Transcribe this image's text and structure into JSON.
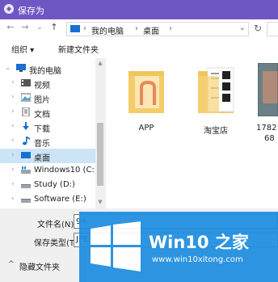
{
  "window": {
    "title": "保存为"
  },
  "nav": {
    "back": "←",
    "forward": "→",
    "dropdown": "⌄",
    "up": "↑",
    "breadcrumbs": [
      "我的电脑",
      "桌面"
    ],
    "refresh": "↻"
  },
  "toolbar": {
    "organize": "组织 ▾",
    "new_folder": "新建文件夹"
  },
  "sidebar": {
    "items": [
      {
        "label": "我的电脑",
        "icon": "computer-icon"
      },
      {
        "label": "视频",
        "icon": "video-icon"
      },
      {
        "label": "图片",
        "icon": "pictures-icon"
      },
      {
        "label": "文档",
        "icon": "documents-icon"
      },
      {
        "label": "下载",
        "icon": "download-icon"
      },
      {
        "label": "音乐",
        "icon": "music-icon"
      },
      {
        "label": "桌面",
        "icon": "desktop-icon"
      },
      {
        "label": "Windows10 (C:)",
        "icon": "drive-c-icon"
      },
      {
        "label": "Study (D:)",
        "icon": "drive-d-icon"
      },
      {
        "label": "Software (E:)",
        "icon": "drive-e-icon"
      }
    ]
  },
  "files": [
    {
      "name": "APP",
      "icon": "folder-icon"
    },
    {
      "name": "淘宝店",
      "icon": "folder-icon"
    },
    {
      "name": "1782",
      "name2": "68",
      "icon": "image-file-icon"
    }
  ],
  "form": {
    "filename_label": "文件名(N):",
    "filename_value": "94,",
    "filetype_label": "保存类型(T):",
    "filetype_value": "JPE"
  },
  "footer": {
    "hide_folders": "隐藏文件夹"
  },
  "watermark": {
    "brand": "Win10 之家",
    "url": "www.win10xitong.com"
  },
  "colors": {
    "titlebar": "#6f57c3",
    "selection": "#cce4f7",
    "folder": "#f7d378",
    "win_blue": "#1e90e0"
  }
}
